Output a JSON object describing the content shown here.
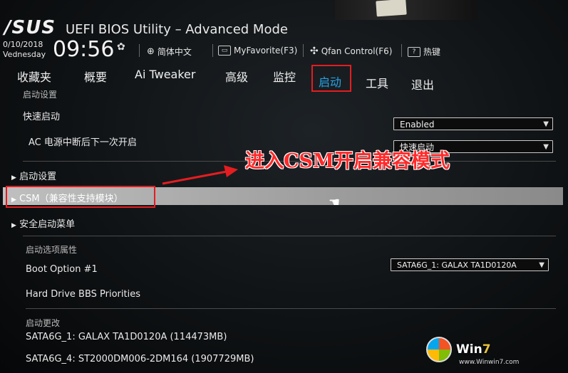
{
  "header": {
    "brand": "/SUS",
    "title": "UEFI BIOS Utility – Advanced Mode",
    "date": "0/10/2018",
    "weekday": "Vednesday",
    "time": "09:56",
    "language": "简体中文",
    "myfavorite": "MyFavorite(F3)",
    "qfan": "Qfan Control(F6)",
    "hotkeys": "热键"
  },
  "tabs": [
    {
      "label": "收藏夹"
    },
    {
      "label": "概要"
    },
    {
      "label": "Ai Tweaker"
    },
    {
      "label": "高级"
    },
    {
      "label": "监控"
    },
    {
      "label": "启动"
    },
    {
      "label": "工具"
    },
    {
      "label": "退出"
    }
  ],
  "content": {
    "boot_config_header": "启动设置",
    "fast_boot_label": "快速启动",
    "fast_boot_value": "Enabled",
    "ac_power_label": "AC 电源中断后下一次开启",
    "ac_power_value": "快速启动",
    "boot_settings_item": "启动设置",
    "csm_item": "CSM（兼容性支持模块）",
    "secure_boot_item": "安全启动菜单",
    "boot_option_header": "启动选项属性",
    "boot_option1_label": "Boot Option #1",
    "boot_option1_value": "SATA6G_1: GALAX TA1D0120A",
    "hdd_bbs_label": "Hard Drive BBS Priorities",
    "boot_override_header": "启动更改",
    "drive1": "SATA6G_1: GALAX TA1D0120A  (114473MB)",
    "drive2": "SATA6G_4: ST2000DM006-2DM164  (1907729MB)"
  },
  "annotation": "进入CSM开启兼容模式",
  "watermark": {
    "brand_prefix": "Win",
    "brand_num": "7",
    "url": "www.Winwin7.com"
  },
  "colors": {
    "active_tab": "#27a3e6",
    "highlight_box": "#e41d20",
    "annotation": "#ff2a2a",
    "selected_row": "#b0b0b0"
  }
}
